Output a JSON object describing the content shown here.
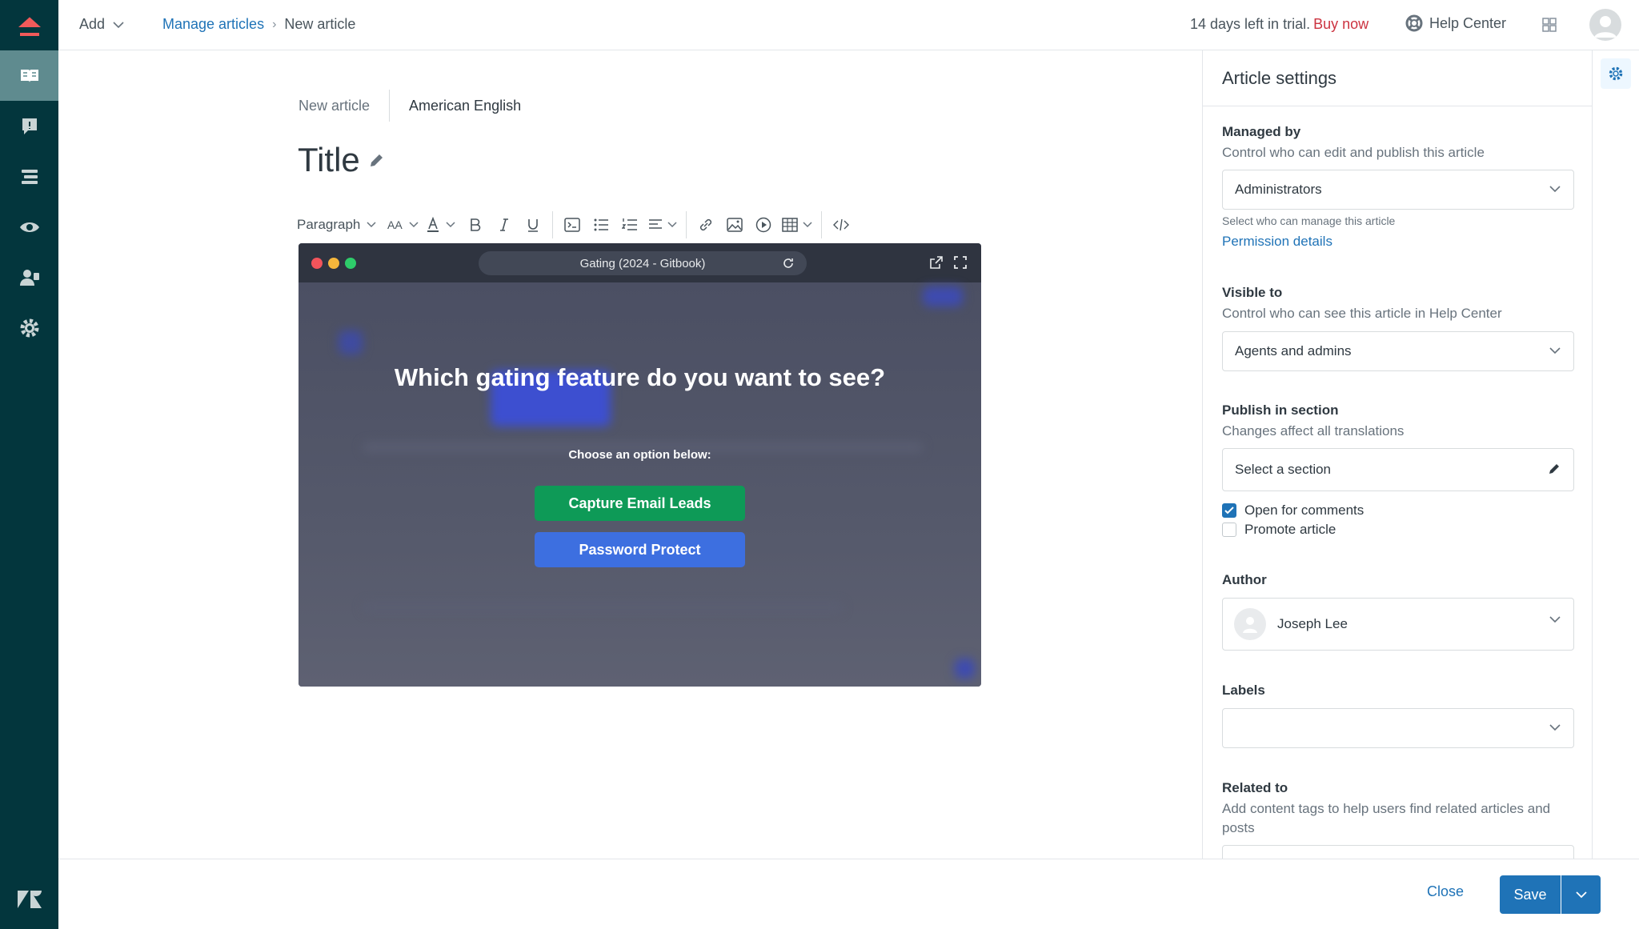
{
  "topbar": {
    "add_label": "Add",
    "breadcrumb": {
      "parent": "Manage articles",
      "current": "New article"
    },
    "trial_text": "14 days left in trial.",
    "buy_label": "Buy now",
    "help_center_label": "Help Center"
  },
  "nav": {
    "items": [
      "guide-icon",
      "feedback-icon",
      "arrange-icon",
      "preview-icon",
      "user-permissions-icon",
      "settings-icon"
    ],
    "active": "guide-icon"
  },
  "editor": {
    "status": "New article",
    "language": "American English",
    "title_placeholder": "Title",
    "toolbar": {
      "paragraph_label": "Paragraph",
      "font_size_label": "AA"
    },
    "embed": {
      "url_title": "Gating (2024 - Gitbook)",
      "question": "Which gating feature do you want to see?",
      "subtitle": "Choose an option below:",
      "button1": "Capture Email Leads",
      "button2": "Password Protect",
      "button1_color": "#0e9a57",
      "button2_color": "#3d6fe0"
    }
  },
  "settings": {
    "title": "Article settings",
    "managed_by": {
      "label": "Managed by",
      "hint": "Control who can edit and publish this article",
      "value": "Administrators",
      "small": "Select who can manage this article",
      "link": "Permission details"
    },
    "visible_to": {
      "label": "Visible to",
      "hint": "Control who can see this article in Help Center",
      "value": "Agents and admins"
    },
    "publish": {
      "label": "Publish in section",
      "hint": "Changes affect all translations",
      "value": "Select a section"
    },
    "open_comments": {
      "label": "Open for comments",
      "checked": true
    },
    "promote": {
      "label": "Promote article",
      "checked": false
    },
    "author": {
      "label": "Author",
      "value": "Joseph Lee"
    },
    "labels": {
      "label": "Labels",
      "value": ""
    },
    "related": {
      "label": "Related to",
      "hint": "Add content tags to help users find related articles and posts"
    }
  },
  "footer": {
    "close_label": "Close",
    "save_label": "Save"
  },
  "colors": {
    "nav_bg": "#03363d",
    "nav_active": "#5f8b8f",
    "primary": "#1f73b7",
    "trial_buy": "#cc3340"
  }
}
